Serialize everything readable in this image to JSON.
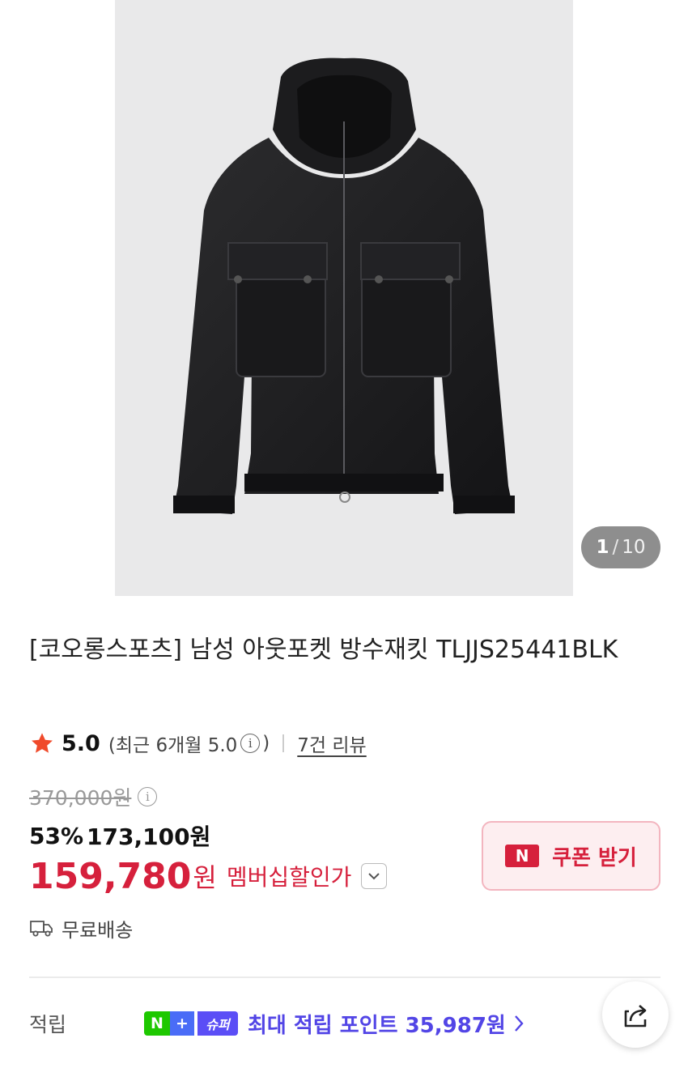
{
  "gallery": {
    "current": "1",
    "separator": "/",
    "total": "10"
  },
  "product": {
    "title": "[코오롱스포츠] 남성 아웃포켓 방수재킷 TLJJS25441BLK"
  },
  "rating": {
    "score": "5.0",
    "recent_prefix": "(최근 6개월 5.0",
    "recent_suffix": ")",
    "reviews": "7건 리뷰",
    "star_color": "#f04a2b"
  },
  "price": {
    "original": "370,000원",
    "discount_pct": "53%",
    "sale_price": "173,100원",
    "member_price": "159,780",
    "member_won": "원",
    "member_label": "멤버십할인가",
    "accent_color": "#d6203c"
  },
  "coupon": {
    "badge": "N",
    "label": "쿠폰 받기"
  },
  "shipping": {
    "label": "무료배송"
  },
  "points": {
    "label": "적립",
    "badge_n": "N",
    "badge_plus": "+",
    "badge_super": "슈퍼",
    "text": "최대 적립 포인트 35,987원"
  },
  "icons": {
    "info": "info-icon",
    "star": "star-icon",
    "truck": "truck-icon",
    "share": "share-icon",
    "chevron_down": "chevron-down-icon",
    "chevron_right": "chevron-right-icon"
  }
}
